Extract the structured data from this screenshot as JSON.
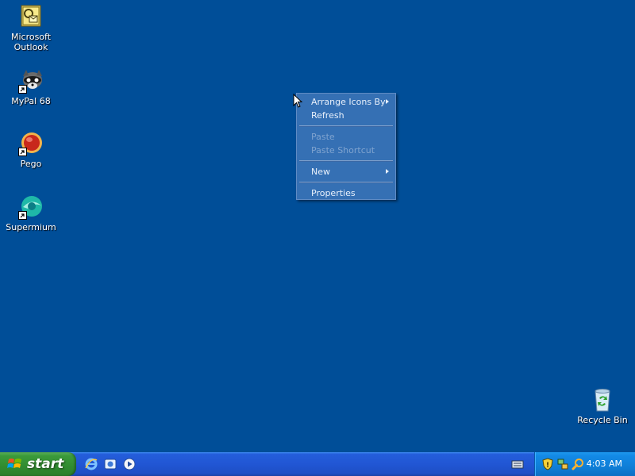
{
  "desktop": {
    "background_color": "#004e98",
    "icons": [
      {
        "label_line1": "Microsoft",
        "label_line2": "Outlook",
        "icon": "outlook-icon"
      },
      {
        "label_line1": "MyPal 68",
        "label_line2": "",
        "icon": "mypal-icon"
      },
      {
        "label_line1": "Pego",
        "label_line2": "",
        "icon": "pego-icon"
      },
      {
        "label_line1": "Supermium",
        "label_line2": "",
        "icon": "supermium-icon"
      },
      {
        "label_line1": "Recycle Bin",
        "label_line2": "",
        "icon": "recycle-bin-icon"
      }
    ]
  },
  "context_menu": {
    "items": [
      {
        "label": "Arrange Icons By",
        "enabled": true,
        "submenu": true
      },
      {
        "label": "Refresh",
        "enabled": true,
        "submenu": false
      },
      {
        "label": "Paste",
        "enabled": false,
        "submenu": false
      },
      {
        "label": "Paste Shortcut",
        "enabled": false,
        "submenu": false
      },
      {
        "label": "New",
        "enabled": true,
        "submenu": true
      },
      {
        "label": "Properties",
        "enabled": true,
        "submenu": false
      }
    ]
  },
  "taskbar": {
    "start_label": "start",
    "quick_launch": [
      "internet-explorer-icon",
      "show-desktop-icon",
      "media-player-icon"
    ],
    "tray_icons": [
      "security-shield-icon",
      "network-icon",
      "search-icon"
    ],
    "clock": "4:03 AM"
  }
}
